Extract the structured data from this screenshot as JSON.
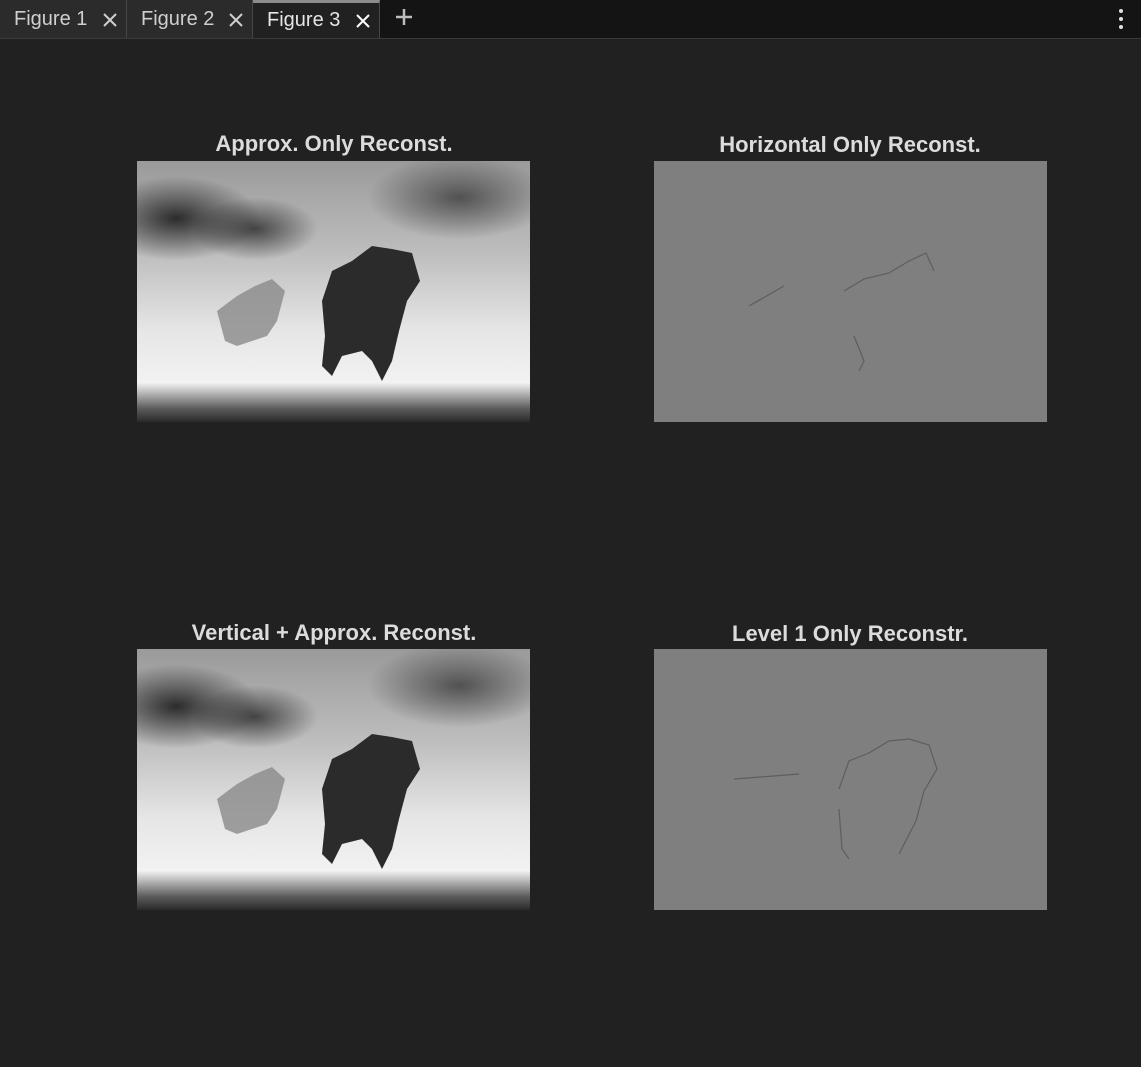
{
  "tabs": [
    {
      "label": "Figure 1",
      "active": false
    },
    {
      "label": "Figure 2",
      "active": false
    },
    {
      "label": "Figure 3",
      "active": true
    }
  ],
  "icons": {
    "close": "close-icon",
    "new_tab": "plus-icon",
    "menu": "kebab-menu-icon"
  },
  "figure": {
    "panels": [
      {
        "title": "Approx. Only Reconst.",
        "image": "grayscale horse photo"
      },
      {
        "title": "Horizontal Only Reconst.",
        "image": "horizontal detail coefficients"
      },
      {
        "title": "Vertical + Approx. Reconst.",
        "image": "grayscale horse photo"
      },
      {
        "title": "Level 1 Only Reconstr.",
        "image": "level 1 detail coefficients"
      }
    ]
  },
  "colors": {
    "background": "#212121",
    "tabbar": "#141414",
    "detail_gray": "#7f7f7f"
  }
}
